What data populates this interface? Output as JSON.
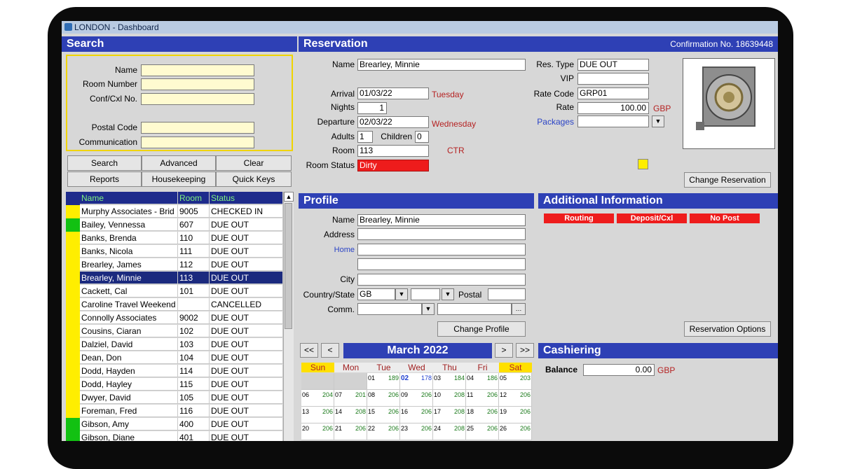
{
  "window": {
    "title": "LONDON - Dashboard"
  },
  "search": {
    "header": "Search",
    "fields": {
      "name": "Name",
      "room_number": "Room Number",
      "conf_cxl": "Conf/Cxl No.",
      "postal_code": "Postal Code",
      "communication": "Communication"
    },
    "buttons": {
      "search": "Search",
      "advanced": "Advanced",
      "clear": "Clear",
      "reports": "Reports",
      "housekeeping": "Housekeeping",
      "quick_keys": "Quick Keys"
    }
  },
  "guest_table": {
    "columns": [
      "Name",
      "Room",
      "Status"
    ],
    "rows": [
      {
        "name": "Murphy Associates - Brid",
        "room": "9005",
        "status": "CHECKED IN",
        "ind": "#ffee00"
      },
      {
        "name": "Bailey, Vennessa",
        "room": "607",
        "status": "DUE OUT",
        "ind": "#12c112"
      },
      {
        "name": "Banks, Brenda",
        "room": "110",
        "status": "DUE OUT",
        "ind": "#ffee00"
      },
      {
        "name": "Banks, Nicola",
        "room": "111",
        "status": "DUE OUT",
        "ind": "#ffee00"
      },
      {
        "name": "Brearley, James",
        "room": "112",
        "status": "DUE OUT",
        "ind": "#ffee00"
      },
      {
        "name": "Brearley, Minnie",
        "room": "113",
        "status": "DUE OUT",
        "ind": "#ffee00",
        "selected": true
      },
      {
        "name": "Cackett, Cal",
        "room": "101",
        "status": "DUE OUT",
        "ind": "#ffee00"
      },
      {
        "name": "Caroline Travel Weekend",
        "room": "",
        "status": "CANCELLED",
        "ind": "#ffee00"
      },
      {
        "name": "Connolly Associates",
        "room": "9002",
        "status": "DUE OUT",
        "ind": "#ffee00"
      },
      {
        "name": "Cousins, Ciaran",
        "room": "102",
        "status": "DUE OUT",
        "ind": "#ffee00"
      },
      {
        "name": "Dalziel, David",
        "room": "103",
        "status": "DUE OUT",
        "ind": "#ffee00"
      },
      {
        "name": "Dean, Don",
        "room": "104",
        "status": "DUE OUT",
        "ind": "#ffee00"
      },
      {
        "name": "Dodd, Hayden",
        "room": "114",
        "status": "DUE OUT",
        "ind": "#ffee00"
      },
      {
        "name": "Dodd, Hayley",
        "room": "115",
        "status": "DUE OUT",
        "ind": "#ffee00"
      },
      {
        "name": "Dwyer, David",
        "room": "105",
        "status": "DUE OUT",
        "ind": "#ffee00"
      },
      {
        "name": "Foreman, Fred",
        "room": "116",
        "status": "DUE OUT",
        "ind": "#ffee00"
      },
      {
        "name": "Gibson, Amy",
        "room": "400",
        "status": "DUE OUT",
        "ind": "#12c112"
      },
      {
        "name": "Gibson, Diane",
        "room": "401",
        "status": "DUE OUT",
        "ind": "#12c112"
      }
    ]
  },
  "reservation": {
    "header": "Reservation",
    "confirmation": "Confirmation No. 18639448",
    "labels": {
      "name": "Name",
      "arrival": "Arrival",
      "nights": "Nights",
      "departure": "Departure",
      "adults": "Adults",
      "children": "Children",
      "room": "Room",
      "room_status": "Room Status",
      "res_type": "Res. Type",
      "vip": "VIP",
      "rate_code": "Rate Code",
      "rate": "Rate",
      "packages": "Packages"
    },
    "values": {
      "name": "Brearley, Minnie",
      "arrival": "01/03/22",
      "arrival_day": "Tuesday",
      "nights": "1",
      "departure": "02/03/22",
      "departure_day": "Wednesday",
      "adults": "1",
      "children": "0",
      "room": "113",
      "room_type": "CTR",
      "room_status": "Dirty",
      "res_type": "DUE OUT",
      "vip": "",
      "rate_code": "GRP01",
      "rate": "100.00",
      "currency": "GBP",
      "packages": ""
    },
    "change_button": "Change Reservation"
  },
  "profile": {
    "header": "Profile",
    "labels": {
      "name": "Name",
      "address": "Address",
      "home": "Home",
      "city": "City",
      "country_state": "Country/State",
      "postal": "Postal",
      "comm": "Comm."
    },
    "values": {
      "name": "Brearley, Minnie",
      "country": "GB"
    },
    "change_button": "Change Profile"
  },
  "additional": {
    "header": "Additional Information",
    "tags": [
      "Routing",
      "Deposit/Cxl",
      "No Post"
    ],
    "options_button": "Reservation Options"
  },
  "calendar": {
    "month": "March 2022",
    "nav": {
      "first": "<<",
      "prev": "<",
      "next": ">",
      "last": ">>"
    },
    "days": [
      "Sun",
      "Mon",
      "Tue",
      "Wed",
      "Thu",
      "Fri",
      "Sat"
    ],
    "weeks": [
      [
        [
          "",
          ""
        ],
        [
          "",
          ""
        ],
        [
          "01",
          "189"
        ],
        [
          "02",
          "178"
        ],
        [
          "03",
          "184"
        ],
        [
          "04",
          "186"
        ],
        [
          "05",
          "203"
        ]
      ],
      [
        [
          "06",
          "204"
        ],
        [
          "07",
          "201"
        ],
        [
          "08",
          "206"
        ],
        [
          "09",
          "206"
        ],
        [
          "10",
          "208"
        ],
        [
          "11",
          "206"
        ],
        [
          "12",
          "206"
        ]
      ],
      [
        [
          "13",
          "206"
        ],
        [
          "14",
          "208"
        ],
        [
          "15",
          "206"
        ],
        [
          "16",
          "206"
        ],
        [
          "17",
          "208"
        ],
        [
          "18",
          "206"
        ],
        [
          "19",
          "206"
        ]
      ],
      [
        [
          "20",
          "206"
        ],
        [
          "21",
          "206"
        ],
        [
          "22",
          "206"
        ],
        [
          "23",
          "206"
        ],
        [
          "24",
          "208"
        ],
        [
          "25",
          "206"
        ],
        [
          "26",
          "206"
        ]
      ]
    ]
  },
  "cashiering": {
    "header": "Cashiering",
    "balance_label": "Balance",
    "balance": "0.00",
    "currency": "GBP"
  },
  "colors": {
    "header_blue": "#2e40b5",
    "selected_row": "#1b2a7e",
    "status_red": "#ee1c1c"
  }
}
